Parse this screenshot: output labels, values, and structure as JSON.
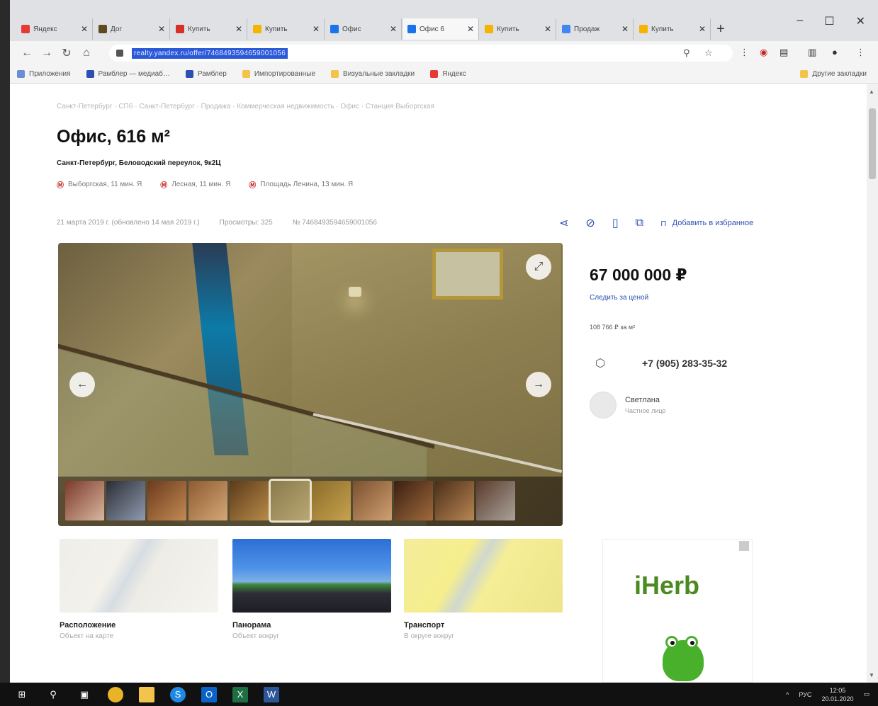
{
  "browser": {
    "tabs": [
      {
        "label": "Яндекс",
        "color": "#e53935"
      },
      {
        "label": "Дог",
        "color": "#5d4a1f"
      },
      {
        "label": "Купить",
        "color": "#d93025"
      },
      {
        "label": "Купить",
        "color": "#f4b400"
      },
      {
        "label": "Офис",
        "color": "#1a73e8"
      },
      {
        "label": "Офис 6",
        "color": "#1a73e8"
      },
      {
        "label": "Купить",
        "color": "#f4b400"
      },
      {
        "label": "Продаж",
        "color": "#4285f4"
      },
      {
        "label": "Купить",
        "color": "#f4b400"
      }
    ],
    "url": "realty.yandex.ru/offer/7468493594659001056",
    "bookmarks": [
      "Приложения",
      "Рамблер — медиаб…",
      "Рамблер",
      "Импортированные",
      "Визуальные закладки",
      "Яндекс"
    ],
    "bookmarks_other": "Другие закладки"
  },
  "listing": {
    "breadcrumbs": "Санкт-Петербург · СПб · Санкт-Петербург · Продажа · Коммерческая недвижимость · Офис · Станция Выборгская",
    "title": "Офис, 616 м²",
    "address": "Санкт-Петербург, Беловодский переулок, 9к2Ц",
    "metro": [
      {
        "name": "Выборгская, 11 мин. Я",
        "color": "#c62828"
      },
      {
        "name": "Лесная, 11 мин. Я",
        "color": "#c62828"
      },
      {
        "name": "Площадь Ленина, 13 мин. Я",
        "color": "#c62828"
      }
    ],
    "date": "21 марта 2019 г. (обновлено 14 мая 2019 г.)",
    "views": "Просмотры: 325",
    "offer_id": "№ 7468493594659001056",
    "favorite_label": "Добавить в избранное",
    "price": "67 000 000 ₽",
    "price_watch": "Следить за ценой",
    "price_per_m2": "108 766 ₽ за м²",
    "phone": "+7 (905) 283-35-32",
    "seller_name": "Светлана",
    "seller_role": "Частное лицо",
    "cards": [
      {
        "name": "Расположение",
        "sub": "Объект на карте"
      },
      {
        "name": "Панорама",
        "sub": "Объект вокруг"
      },
      {
        "name": "Транспорт",
        "sub": "В округе вокруг"
      }
    ],
    "ad_logo": "iHerb"
  },
  "taskbar": {
    "lang": "РУС",
    "time": "12:05",
    "date": "20.01.2020"
  }
}
